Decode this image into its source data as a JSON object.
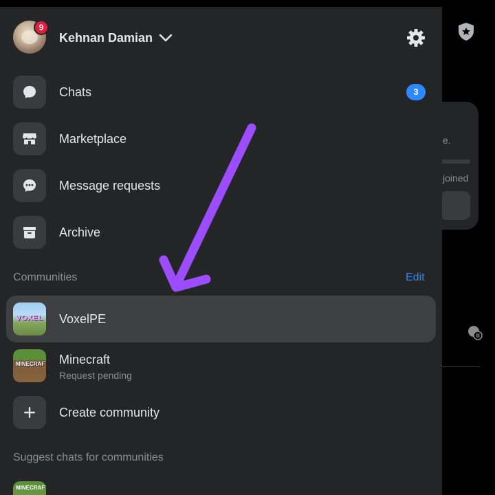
{
  "background": {
    "card_fragment_1": "e.",
    "card_fragment_2": "joined"
  },
  "header": {
    "username": "Kehnan Damian",
    "notification_count": "9"
  },
  "menu": [
    {
      "label": "Chats",
      "icon": "chat-bubble-icon",
      "badge": "3"
    },
    {
      "label": "Marketplace",
      "icon": "storefront-icon"
    },
    {
      "label": "Message requests",
      "icon": "message-requests-icon"
    },
    {
      "label": "Archive",
      "icon": "archive-box-icon"
    }
  ],
  "communities": {
    "title": "Communities",
    "edit_label": "Edit",
    "items": [
      {
        "label": "VoxelPE",
        "thumb_text": "VOXEL",
        "selected": true
      },
      {
        "label": "Minecraft",
        "subtitle": "Request pending",
        "thumb_text": "MINECRAFT"
      }
    ],
    "create_label": "Create community"
  },
  "suggest": {
    "title": "Suggest chats for communities",
    "thumb_text": "MINECRAFT"
  },
  "colors": {
    "drawer_bg": "#242526",
    "accent_blue": "#2d88ff",
    "badge_red": "#e41e3f",
    "annotation_arrow": "#9b4dff"
  }
}
